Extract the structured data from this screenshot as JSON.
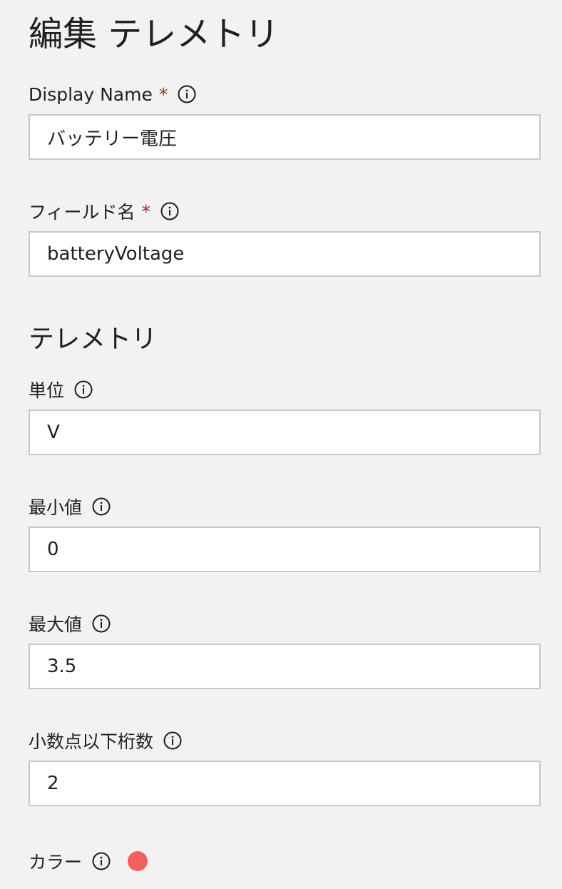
{
  "page": {
    "title": "編集 テレメトリ"
  },
  "fields": {
    "display_name": {
      "label": "Display Name",
      "required_mark": "*",
      "value": "バッテリー電圧"
    },
    "field_name": {
      "label": "フィールド名",
      "required_mark": "*",
      "value": "batteryVoltage"
    }
  },
  "telemetry_section": {
    "title": "テレメトリ",
    "unit": {
      "label": "単位",
      "value": "V"
    },
    "min_value": {
      "label": "最小値",
      "value": "0"
    },
    "max_value": {
      "label": "最大値",
      "value": "3.5"
    },
    "decimal_places": {
      "label": "小数点以下桁数",
      "value": "2"
    },
    "color": {
      "label": "カラー",
      "value": "#f46060"
    }
  },
  "icons": {
    "info": "info-icon",
    "color": "color-swatch"
  }
}
